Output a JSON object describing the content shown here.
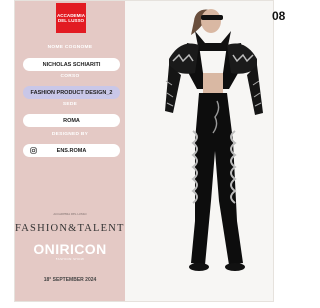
{
  "logo": {
    "line1": "ACCADEMIA",
    "line2": "DEL LUSSO"
  },
  "fields": {
    "name_label": "NOME COGNOME",
    "name_value": "NICHOLAS SCHIARITI",
    "course_label": "CORSO",
    "course_value": "FASHION PRODUCT DESIGN_2",
    "campus_label": "SEDE",
    "campus_value": "ROMA",
    "designed_label": "DESIGNED BY",
    "handle_value": "ENS.ROMA"
  },
  "event": {
    "small_text": "ACCADEMIA DEL LUSSO",
    "fashion_title": "FASHION&TALENTS",
    "oniricon": "ONIRICON",
    "oniricon_sub": "FASHION SHOW",
    "date": "18° SEPTEMBER 2024"
  },
  "corner_text": "08",
  "colors": {
    "panel": "#e4c9c5",
    "logo_red": "#e21b22",
    "pill_active": "#c9c7e8"
  },
  "icons": [
    "instagram-icon"
  ]
}
